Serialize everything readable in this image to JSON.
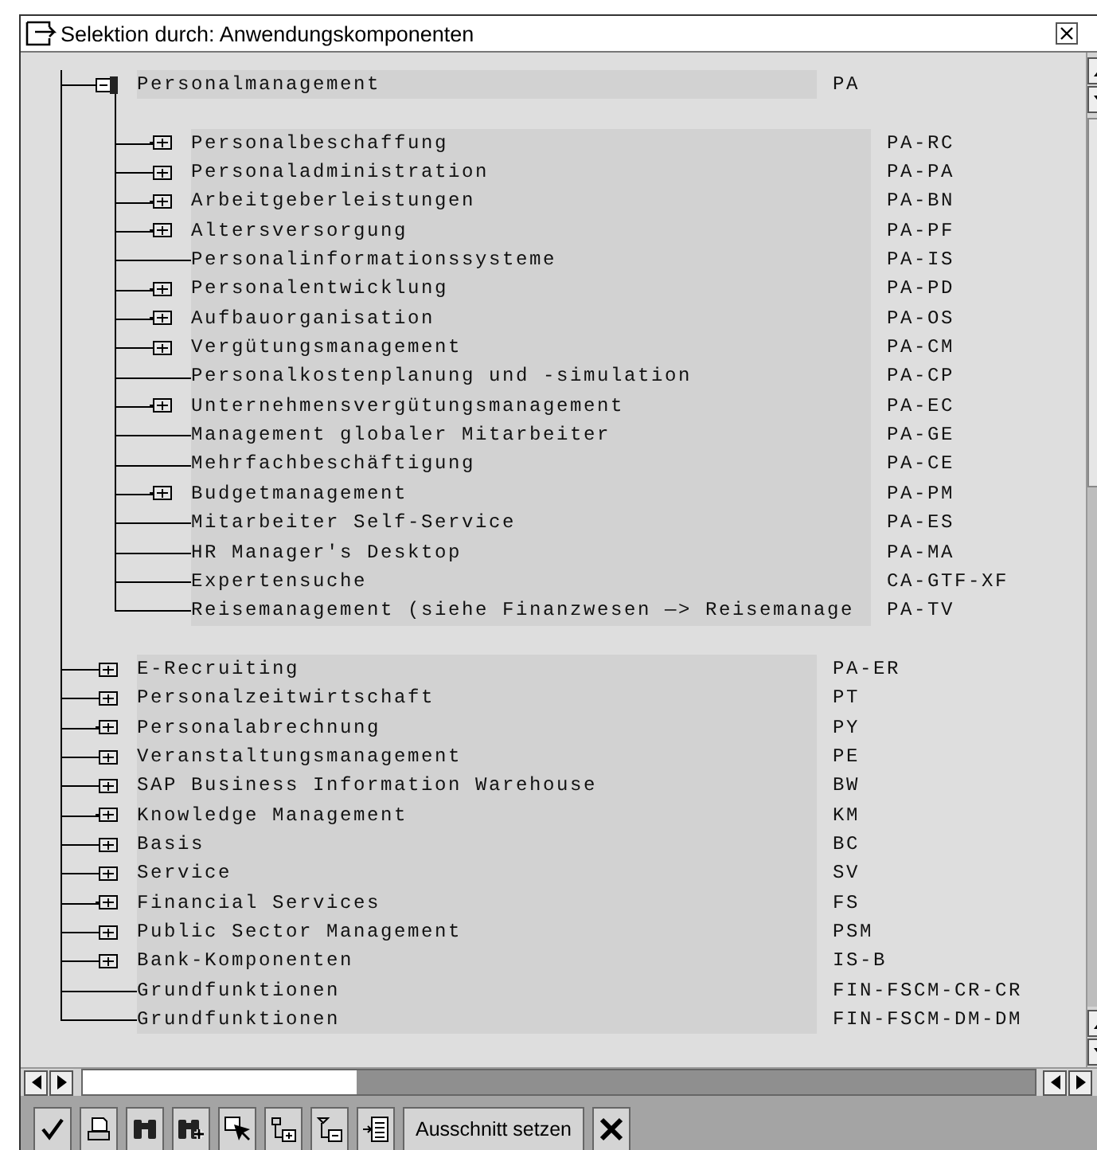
{
  "window": {
    "title": "Selektion durch: Anwendungskomponenten"
  },
  "tree": [
    {
      "label": "Personalmanagement",
      "code": "PA",
      "kind": "node",
      "expanded": true,
      "children": [
        {
          "label": "Personalbeschaffung",
          "code": "PA-RC",
          "kind": "node",
          "expanded": false
        },
        {
          "label": "Personaladministration",
          "code": "PA-PA",
          "kind": "node",
          "expanded": false
        },
        {
          "label": "Arbeitgeberleistungen",
          "code": "PA-BN",
          "kind": "node",
          "expanded": false
        },
        {
          "label": "Altersversorgung",
          "code": "PA-PF",
          "kind": "node",
          "expanded": false
        },
        {
          "label": "Personalinformationssysteme",
          "code": "PA-IS",
          "kind": "leaf"
        },
        {
          "label": "Personalentwicklung",
          "code": "PA-PD",
          "kind": "node",
          "expanded": false
        },
        {
          "label": "Aufbauorganisation",
          "code": "PA-OS",
          "kind": "node",
          "expanded": false
        },
        {
          "label": "Vergütungsmanagement",
          "code": "PA-CM",
          "kind": "node",
          "expanded": false
        },
        {
          "label": "Personalkostenplanung und -simulation",
          "code": "PA-CP",
          "kind": "leaf"
        },
        {
          "label": "Unternehmensvergütungsmanagement",
          "code": "PA-EC",
          "kind": "node",
          "expanded": false
        },
        {
          "label": "Management globaler Mitarbeiter",
          "code": "PA-GE",
          "kind": "leaf"
        },
        {
          "label": "Mehrfachbeschäftigung",
          "code": "PA-CE",
          "kind": "leaf"
        },
        {
          "label": "Budgetmanagement",
          "code": "PA-PM",
          "kind": "node",
          "expanded": false
        },
        {
          "label": "Mitarbeiter Self-Service",
          "code": "PA-ES",
          "kind": "leaf"
        },
        {
          "label": "HR Manager's Desktop",
          "code": "PA-MA",
          "kind": "leaf"
        },
        {
          "label": "Expertensuche",
          "code": "CA-GTF-XF",
          "kind": "leaf"
        },
        {
          "label": "Reisemanagement (siehe Finanzwesen —> Reisemanage",
          "code": "PA-TV",
          "kind": "leaf"
        }
      ]
    },
    {
      "label": "E-Recruiting",
      "code": "PA-ER",
      "kind": "node",
      "expanded": false
    },
    {
      "label": "Personalzeitwirtschaft",
      "code": "PT",
      "kind": "node",
      "expanded": false
    },
    {
      "label": "Personalabrechnung",
      "code": "PY",
      "kind": "node",
      "expanded": false
    },
    {
      "label": "Veranstaltungsmanagement",
      "code": "PE",
      "kind": "node",
      "expanded": false
    },
    {
      "label": "SAP Business Information Warehouse",
      "code": "BW",
      "kind": "node",
      "expanded": false
    },
    {
      "label": "Knowledge Management",
      "code": "KM",
      "kind": "node",
      "expanded": false
    },
    {
      "label": "Basis",
      "code": "BC",
      "kind": "node",
      "expanded": false
    },
    {
      "label": "Service",
      "code": "SV",
      "kind": "node",
      "expanded": false
    },
    {
      "label": "Financial Services",
      "code": "FS",
      "kind": "node",
      "expanded": false
    },
    {
      "label": "Public Sector Management",
      "code": "PSM",
      "kind": "node",
      "expanded": false
    },
    {
      "label": "Bank-Komponenten",
      "code": "IS-B",
      "kind": "node",
      "expanded": false
    },
    {
      "label": "Grundfunktionen",
      "code": "FIN-FSCM-CR-CR",
      "kind": "leaf"
    },
    {
      "label": "Grundfunktionen",
      "code": "FIN-FSCM-DM-DM",
      "kind": "leaf"
    }
  ],
  "toolbar": [
    {
      "kind": "check"
    },
    {
      "kind": "print"
    },
    {
      "kind": "find"
    },
    {
      "kind": "find-next"
    },
    {
      "kind": "select"
    },
    {
      "kind": "expand"
    },
    {
      "kind": "collapse"
    },
    {
      "kind": "subtree"
    },
    {
      "kind": "text",
      "label": "Ausschnitt setzen"
    },
    {
      "kind": "cancel"
    }
  ]
}
